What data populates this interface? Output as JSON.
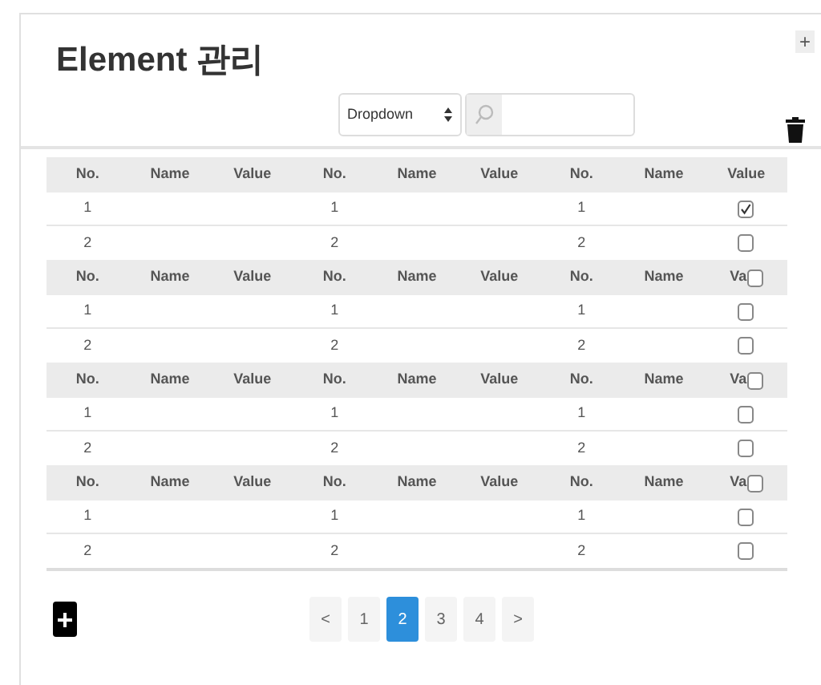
{
  "title": "Element 관리",
  "corner_button": "+",
  "dropdown": {
    "value": "Dropdown"
  },
  "groups": [
    {
      "columns": [
        "No.",
        "Name",
        "Value",
        "No.",
        "Name",
        "Value",
        "No.",
        "Name",
        "Value"
      ],
      "rows": [
        {
          "numbers": [
            "1",
            "1",
            "1"
          ],
          "checked": true
        },
        {
          "numbers": [
            "2",
            "2",
            "2"
          ],
          "checked": false
        }
      ]
    },
    {
      "columns": [
        "No.",
        "Name",
        "Value",
        "No.",
        "Name",
        "Value",
        "No.",
        "Name",
        "Va"
      ],
      "header_checkbox": {
        "checked": false
      },
      "rows": [
        {
          "numbers": [
            "1",
            "1",
            "1"
          ],
          "checked": false
        },
        {
          "numbers": [
            "2",
            "2",
            "2"
          ],
          "checked": false
        }
      ]
    },
    {
      "columns": [
        "No.",
        "Name",
        "Value",
        "No.",
        "Name",
        "Value",
        "No.",
        "Name",
        "Va"
      ],
      "header_checkbox": {
        "checked": false
      },
      "rows": [
        {
          "numbers": [
            "1",
            "1",
            "1"
          ],
          "checked": false
        },
        {
          "numbers": [
            "2",
            "2",
            "2"
          ],
          "checked": false
        }
      ]
    },
    {
      "columns": [
        "No.",
        "Name",
        "Value",
        "No.",
        "Name",
        "Value",
        "No.",
        "Name",
        "Va"
      ],
      "header_checkbox": {
        "checked": false
      },
      "rows": [
        {
          "numbers": [
            "1",
            "1",
            "1"
          ],
          "checked": false
        },
        {
          "numbers": [
            "2",
            "2",
            "2"
          ],
          "checked": false
        }
      ]
    }
  ],
  "pagination": {
    "prev": "<",
    "next": ">",
    "pages": [
      {
        "label": "1",
        "selected": false
      },
      {
        "label": "2",
        "selected": true
      },
      {
        "label": "3",
        "selected": false
      },
      {
        "label": "4",
        "selected": false
      }
    ]
  }
}
